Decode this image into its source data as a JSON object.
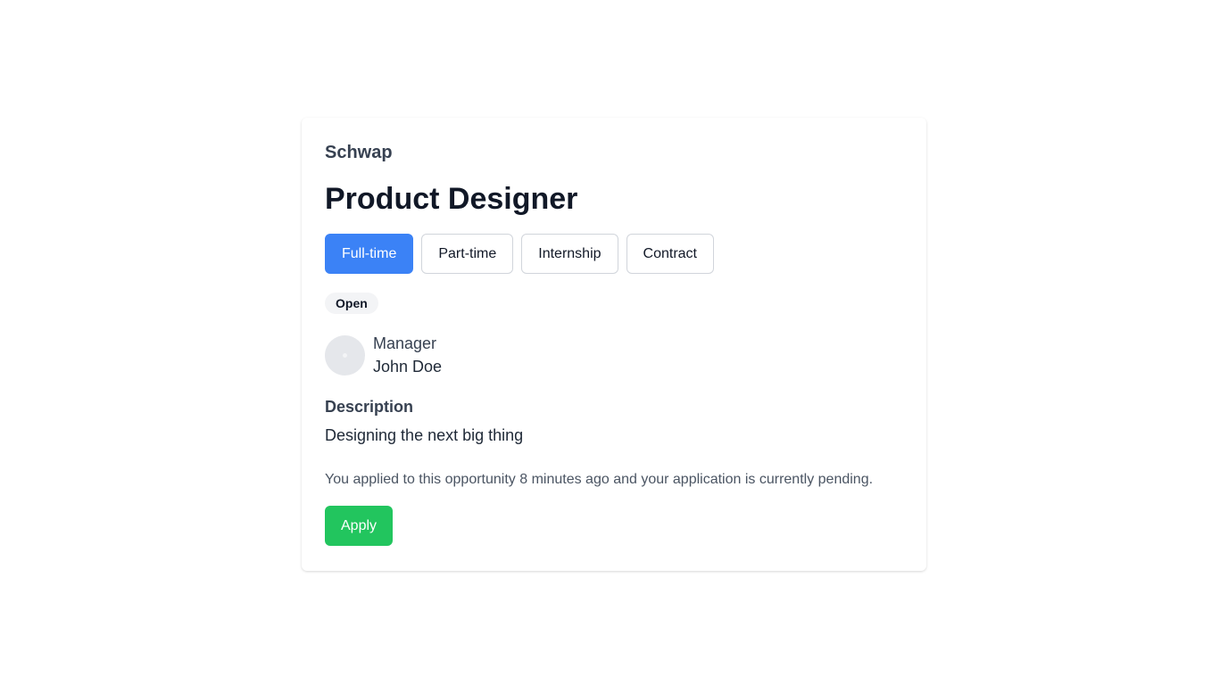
{
  "job": {
    "company": "Schwap",
    "title": "Product Designer",
    "employment_types": [
      {
        "label": "Full-time",
        "selected": true
      },
      {
        "label": "Part-time",
        "selected": false
      },
      {
        "label": "Internship",
        "selected": false
      },
      {
        "label": "Contract",
        "selected": false
      }
    ],
    "status_badge": "Open",
    "manager": {
      "role": "Manager",
      "name": "John Doe",
      "avatar_icon": "avatar-placeholder-icon"
    },
    "description": {
      "label": "Description",
      "text": "Designing the next big thing"
    },
    "application_status": "You applied to this opportunity 8 minutes ago and your application is currently pending.",
    "apply_label": "Apply"
  },
  "colors": {
    "primary": "#3b82f6",
    "success": "#22c55e",
    "badge_bg": "#f3f4f6",
    "avatar_bg": "#e5e7eb"
  }
}
